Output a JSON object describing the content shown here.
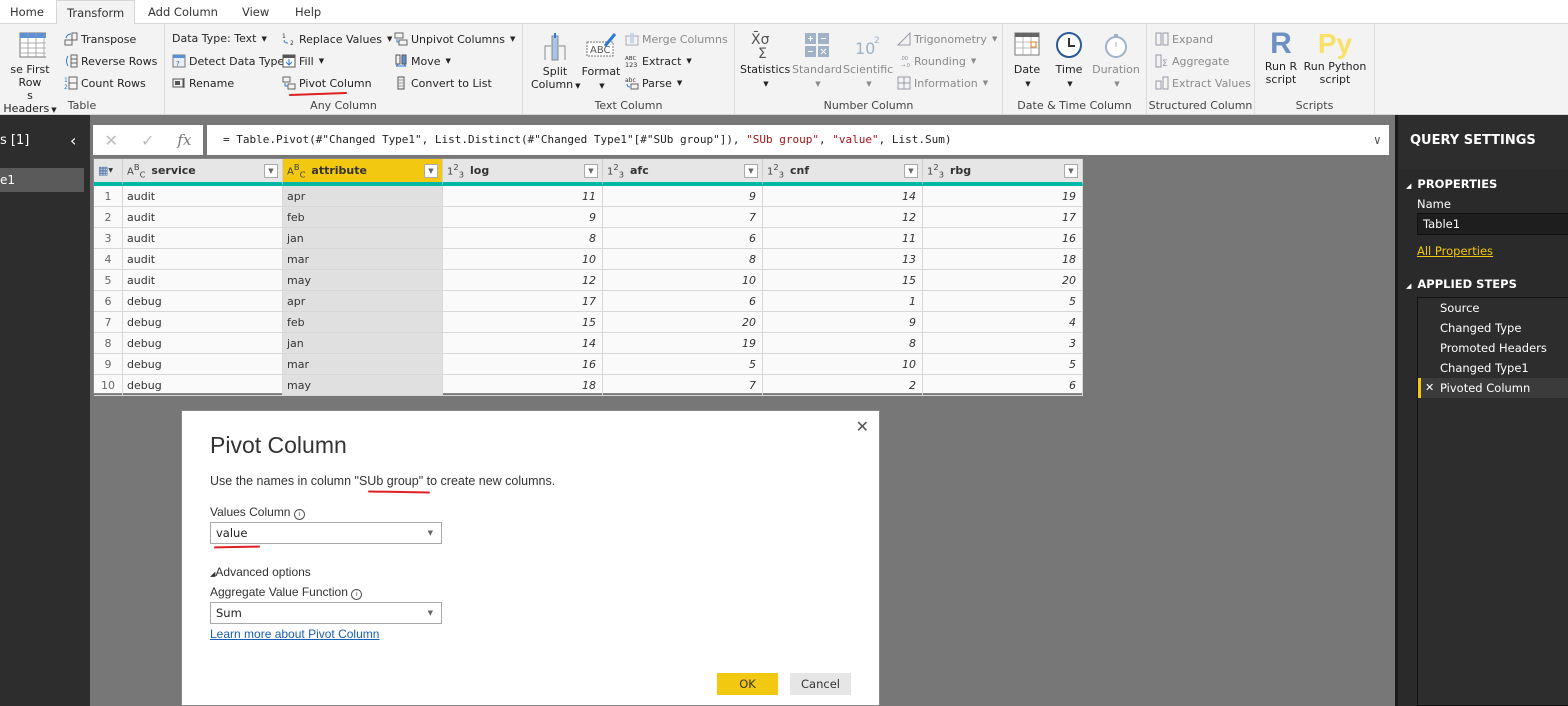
{
  "tabs": [
    {
      "label": "Home",
      "active": false
    },
    {
      "label": "Transform",
      "active": true
    },
    {
      "label": "Add Column",
      "active": false
    },
    {
      "label": "View",
      "active": false
    },
    {
      "label": "Help",
      "active": false
    }
  ],
  "ribbon": {
    "table": {
      "label": "Table",
      "use_first_row_line1": "se First Row",
      "use_first_row_line2": "s Headers",
      "transpose": "Transpose",
      "reverse_rows": "Reverse Rows",
      "count_rows": "Count Rows"
    },
    "any_column": {
      "label": "Any Column",
      "data_type": "Data Type: Text",
      "detect_data_type": "Detect Data Type",
      "rename": "Rename",
      "replace_values": "Replace Values",
      "fill": "Fill",
      "pivot_column": "Pivot Column",
      "unpivot_columns": "Unpivot Columns",
      "move": "Move",
      "convert_to_list": "Convert to List"
    },
    "text_column": {
      "label": "Text Column",
      "split_column_line1": "Split",
      "split_column_line2": "Column",
      "format": "Format",
      "merge_columns": "Merge Columns",
      "extract": "Extract",
      "parse": "Parse"
    },
    "number_column": {
      "label": "Number Column",
      "statistics": "Statistics",
      "standard": "Standard",
      "scientific": "Scientific",
      "trigonometry": "Trigonometry",
      "rounding": "Rounding",
      "information": "Information"
    },
    "datetime_column": {
      "label": "Date & Time Column",
      "date": "Date",
      "time": "Time",
      "duration": "Duration"
    },
    "structured_column": {
      "label": "Structured Column",
      "expand": "Expand",
      "aggregate": "Aggregate",
      "extract_values": "Extract Values"
    },
    "scripts": {
      "label": "Scripts",
      "run_r_line1": "Run R",
      "run_r_line2": "script",
      "run_python_line1": "Run Python",
      "run_python_line2": "script"
    }
  },
  "leftnav": {
    "title": "s [1]",
    "query": "e1"
  },
  "formula": {
    "prefix": "= Table.Pivot(#\"Changed Type1\", List.Distinct(#\"Changed Type1\"[#\"SUb group\"]), ",
    "arg1": "\"SUb group\"",
    "sep1": ", ",
    "arg2": "\"value\"",
    "suffix": ", List.Sum)"
  },
  "grid": {
    "columns": [
      {
        "name": "service",
        "type": "ABC",
        "selected": false
      },
      {
        "name": "attribute",
        "type": "ABC",
        "selected": true
      },
      {
        "name": "log",
        "type": "123",
        "selected": false
      },
      {
        "name": "afc",
        "type": "123",
        "selected": false
      },
      {
        "name": "cnf",
        "type": "123",
        "selected": false
      },
      {
        "name": "rbg",
        "type": "123",
        "selected": false
      }
    ],
    "rows": [
      [
        "1",
        "audit",
        "apr",
        "11",
        "9",
        "14",
        "19"
      ],
      [
        "2",
        "audit",
        "feb",
        "9",
        "7",
        "12",
        "17"
      ],
      [
        "3",
        "audit",
        "jan",
        "8",
        "6",
        "11",
        "16"
      ],
      [
        "4",
        "audit",
        "mar",
        "10",
        "8",
        "13",
        "18"
      ],
      [
        "5",
        "audit",
        "may",
        "12",
        "10",
        "15",
        "20"
      ],
      [
        "6",
        "debug",
        "apr",
        "17",
        "6",
        "1",
        "5"
      ],
      [
        "7",
        "debug",
        "feb",
        "15",
        "20",
        "9",
        "4"
      ],
      [
        "8",
        "debug",
        "jan",
        "14",
        "19",
        "8",
        "3"
      ],
      [
        "9",
        "debug",
        "mar",
        "16",
        "5",
        "10",
        "5"
      ],
      [
        "10",
        "debug",
        "may",
        "18",
        "7",
        "2",
        "6"
      ]
    ]
  },
  "query_settings": {
    "title": "QUERY SETTINGS",
    "properties_label": "PROPERTIES",
    "name_label": "Name",
    "name_value": "Table1",
    "all_properties": "All Properties",
    "applied_steps_label": "APPLIED STEPS",
    "steps": [
      "Source",
      "Changed Type",
      "Promoted Headers",
      "Changed Type1",
      "Pivoted Column"
    ],
    "active_step": "Pivoted Column"
  },
  "dialog": {
    "title": "Pivot Column",
    "desc_prefix": "Use the names in column \"",
    "desc_column": "SUb group",
    "desc_suffix": "\" to create new columns.",
    "values_column_label": "Values Column",
    "values_column_value": "value",
    "advanced_options": "Advanced options",
    "aggregate_label": "Aggregate Value Function",
    "aggregate_value": "Sum",
    "learn_more": "Learn more about Pivot Column",
    "ok": "OK",
    "cancel": "Cancel"
  },
  "colors": {
    "accent_yellow": "#F2C811",
    "teal": "#00B7A8",
    "annotation_red": "#E02020",
    "dark_panel": "#2D2D2D"
  }
}
